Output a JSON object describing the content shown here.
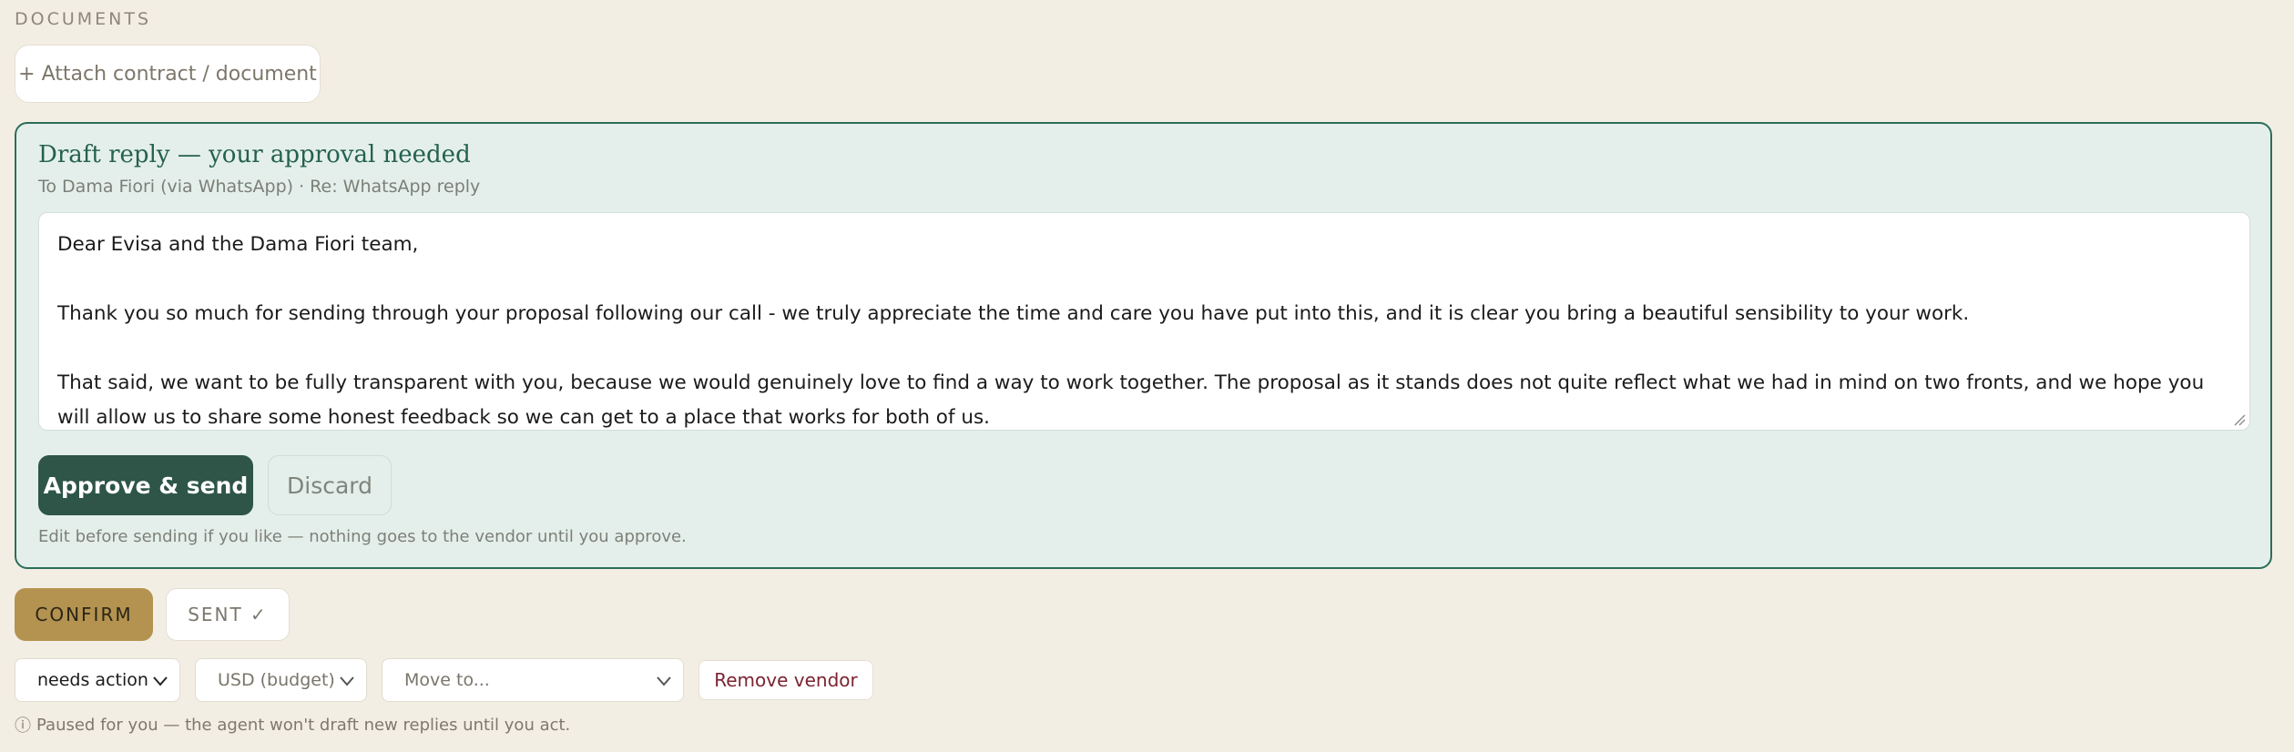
{
  "documents": {
    "section_label": "DOCUMENTS",
    "attach_label": "+ Attach contract / document"
  },
  "draft": {
    "title": "Draft reply — your approval needed",
    "subtitle": "To Dama Fiori (via WhatsApp) · Re: WhatsApp reply",
    "paragraphs": [
      "Dear Evisa and the Dama Fiori team,",
      "Thank you so much for sending through your proposal following our call - we truly appreciate the time and care you have put into this, and it is clear you bring a beautiful sensibility to your work.",
      "That said, we want to be fully transparent with you, because we would genuinely love to find a way to work together. The proposal as it stands does not quite reflect what we had in mind on two fronts, and we hope you will allow us to share some honest feedback so we can get to a place that works for both of us."
    ],
    "approve_label": "Approve & send",
    "discard_label": "Discard",
    "note": "Edit before sending if you like — nothing goes to the vendor until you approve."
  },
  "actions": {
    "confirm_label": "CONFIRM",
    "sent_label": "SENT ✓"
  },
  "controls": {
    "status_value": "needs action",
    "currency_value": "USD (budget)",
    "move_placeholder": "Move to...",
    "remove_label": "Remove vendor",
    "paused_icon": "ⓘ",
    "paused_note": "Paused for you — the agent won't draft new replies until you act."
  },
  "colors": {
    "background": "#f3eee4",
    "draft_panel": "#e4efeb",
    "draft_border": "#2d6d5a",
    "approve": "#2e5547",
    "confirm": "#b3934f",
    "remove_text": "#7c2331"
  }
}
